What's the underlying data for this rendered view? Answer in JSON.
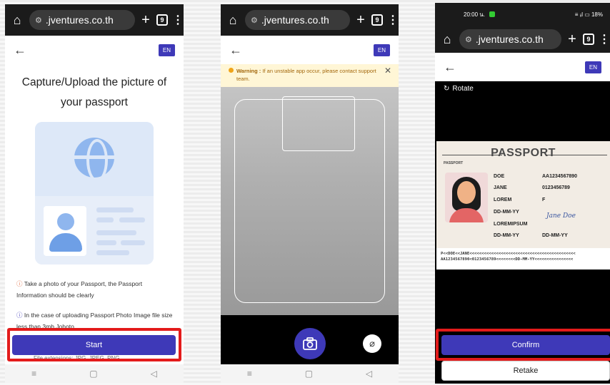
{
  "browser": {
    "url": ".jventures.co.th",
    "tabs_count": "9"
  },
  "header": {
    "lang": "EN"
  },
  "screen1": {
    "title": "Capture/Upload the picture of your passport",
    "info1": "Take a photo of your Passport, the Passport Information should be clearly",
    "info2": "In the case of uploading Passport Photo Image file size less than 3mb Johoto",
    "start_label": "Start",
    "under_text": "File extensions: JPG, JPEG, PNG"
  },
  "screen2": {
    "warning_label": "Warning :",
    "warning_text": "If an unstable app occur, please contact support team."
  },
  "screen3": {
    "status_time": "20:00 น.",
    "status_right": "≡ ᵢᵢl ▭ 18%",
    "rotate_label": "Rotate",
    "passport": {
      "title": "PASSPORT",
      "small_label": "PASSPORT",
      "surname": "DOE",
      "given_name": "JANE",
      "nationality": "LOREM",
      "dob": "DD-MM-YY",
      "pob": "LOREMIPSUM",
      "doi": "DD-MM-YY",
      "passport_no": "AA1234567890",
      "personal_no": "0123456789",
      "sex": "F",
      "doe": "DD-MM-YY",
      "signature": "Jane Doe",
      "mrz1": "P<<DOE<<JANE<<<<<<<<<<<<<<<<<<<<<<<<<<<<<<<<<<<<<<<<<<<<",
      "mrz2": "AA1234567890<0123456789<<<<<<<<DD-MM-YY<<<<<<<<<<<<<<<<"
    },
    "confirm_label": "Confirm",
    "retake_label": "Retake"
  },
  "colors": {
    "primary": "#3e39b8",
    "highlight": "#e31b1b",
    "warning_bg": "#fff6d6"
  }
}
